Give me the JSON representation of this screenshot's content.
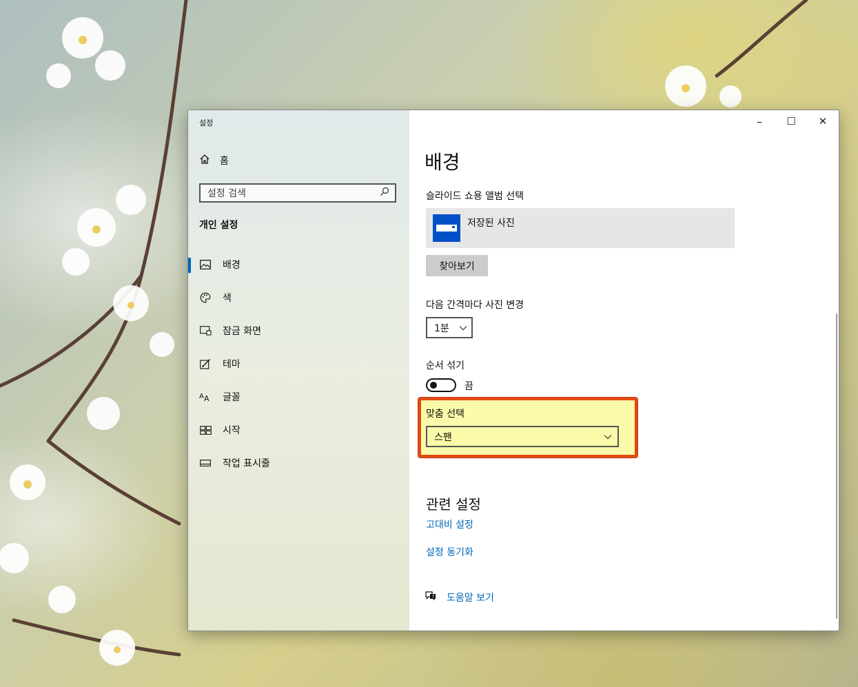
{
  "window": {
    "title": "설정",
    "controls": {
      "minimize": "–",
      "maximize": "☐",
      "close": "✕"
    }
  },
  "sidebar": {
    "home_label": "홈",
    "search_placeholder": "설정 검색",
    "section_title": "개인 설정",
    "items": [
      {
        "label": "배경",
        "icon": "image-icon",
        "active": true
      },
      {
        "label": "색",
        "icon": "palette-icon",
        "active": false
      },
      {
        "label": "잠금 화면",
        "icon": "lock-screen-icon",
        "active": false
      },
      {
        "label": "테마",
        "icon": "theme-icon",
        "active": false
      },
      {
        "label": "글꼴",
        "icon": "font-icon",
        "active": false
      },
      {
        "label": "시작",
        "icon": "start-icon",
        "active": false
      },
      {
        "label": "작업 표시줄",
        "icon": "taskbar-icon",
        "active": false
      }
    ]
  },
  "main": {
    "heading": "배경",
    "album_label": "슬라이드 쇼용 앨범 선택",
    "album_name": "저장된 사진",
    "browse_label": "찾아보기",
    "interval_label": "다음 간격마다 사진 변경",
    "interval_value": "1분",
    "shuffle_label": "순서 섞기",
    "shuffle_state": "끔",
    "fit_label": "맞춤 선택",
    "fit_value": "스팬",
    "related_title": "관련 설정",
    "links": [
      "고대비 설정",
      "설정 동기화"
    ],
    "help_label": "도움말 보기"
  },
  "colors": {
    "accent": "#0067c0",
    "link": "#0067b8",
    "highlight_border": "#e24a10",
    "highlight_fill": "#fafaa8",
    "album_icon": "#0050c8"
  }
}
